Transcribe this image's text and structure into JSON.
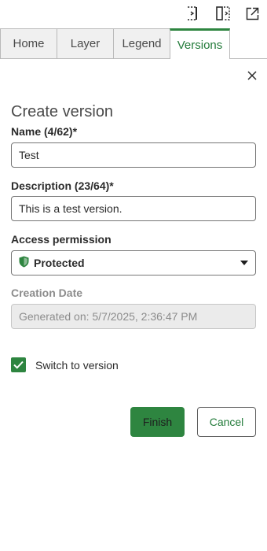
{
  "toolbar": {
    "icons": [
      "dock-side-icon",
      "split-panel-icon",
      "expand-icon"
    ]
  },
  "tabs": [
    {
      "label": "Home",
      "active": false
    },
    {
      "label": "Layer",
      "active": false
    },
    {
      "label": "Legend",
      "active": false
    },
    {
      "label": "Versions",
      "active": true
    }
  ],
  "form": {
    "title": "Create version",
    "name": {
      "label": "Name (4/62)*",
      "value": "Test"
    },
    "description": {
      "label": "Description (23/64)*",
      "value": "This is a test version."
    },
    "access": {
      "label": "Access permission",
      "value": "Protected",
      "icon": "shield-icon"
    },
    "creation_date": {
      "label": "Creation Date",
      "value": "Generated on: 5/7/2025, 2:36:47 PM"
    },
    "switch_to_version": {
      "label": "Switch to version",
      "checked": true
    }
  },
  "actions": {
    "finish": "Finish",
    "cancel": "Cancel"
  },
  "colors": {
    "accent": "#2e8540",
    "accent_text": "#237b3a",
    "border": "#767676",
    "disabled_bg": "#ebebeb"
  }
}
